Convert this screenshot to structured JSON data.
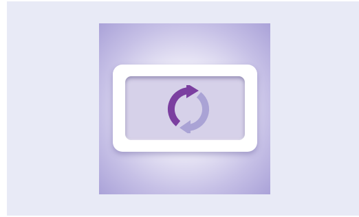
{
  "icon": {
    "name": "sync-icon",
    "colors": {
      "background": "#e8eaf6",
      "tile": "#aaa2d8",
      "frame": "#ffffff",
      "screen": "#d6d1e9",
      "arrow_primary": "#7b3fa0",
      "arrow_secondary": "#aaa3d5"
    }
  }
}
